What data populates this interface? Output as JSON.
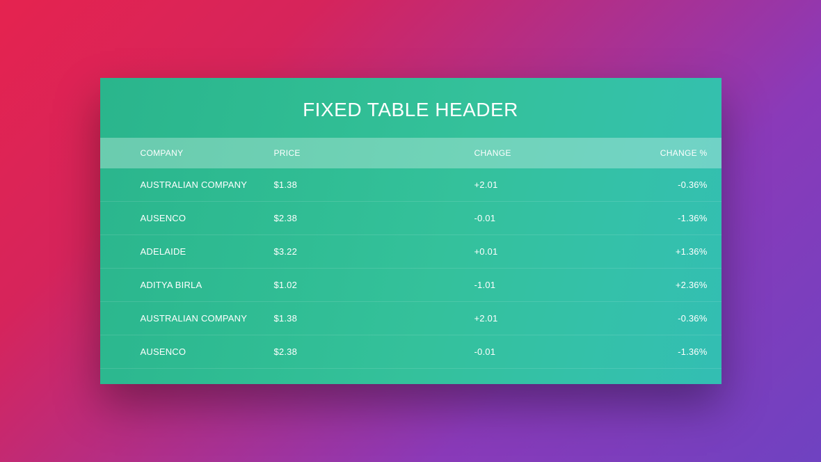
{
  "title": "FIXED TABLE HEADER",
  "columns": {
    "company": "COMPANY",
    "price": "PRICE",
    "change": "CHANGE",
    "pct": "CHANGE %"
  },
  "rows": [
    {
      "company": "AUSTRALIAN COMPANY",
      "price": "$1.38",
      "change": "+2.01",
      "pct": "-0.36%"
    },
    {
      "company": "AUSENCO",
      "price": "$2.38",
      "change": "-0.01",
      "pct": "-1.36%"
    },
    {
      "company": "ADELAIDE",
      "price": "$3.22",
      "change": "+0.01",
      "pct": "+1.36%"
    },
    {
      "company": "ADITYA BIRLA",
      "price": "$1.02",
      "change": "-1.01",
      "pct": "+2.36%"
    },
    {
      "company": "AUSTRALIAN COMPANY",
      "price": "$1.38",
      "change": "+2.01",
      "pct": "-0.36%"
    },
    {
      "company": "AUSENCO",
      "price": "$2.38",
      "change": "-0.01",
      "pct": "-1.36%"
    }
  ]
}
